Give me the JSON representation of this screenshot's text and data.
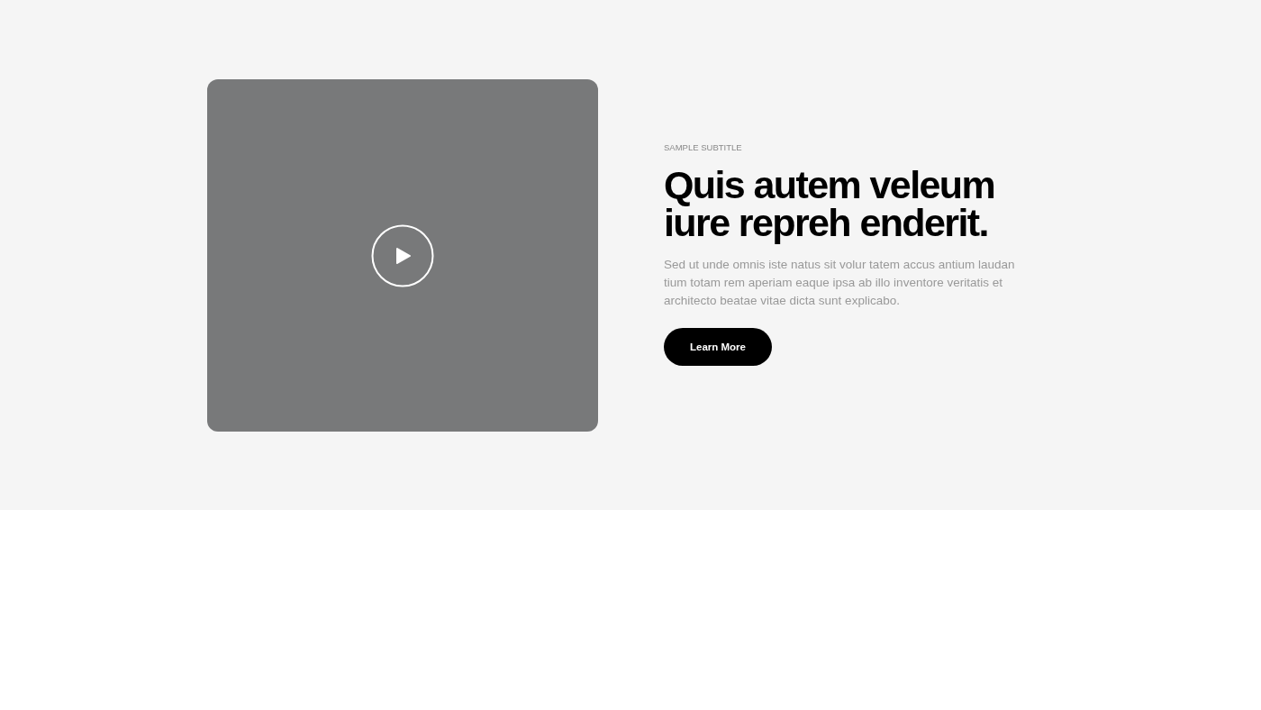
{
  "hero": {
    "subtitle": "SAMPLE SUBTITLE",
    "title": "Quis autem veleum iure repreh enderit.",
    "body": "Sed ut unde omnis iste natus sit volur tatem accus antium laudan tium totam rem aperiam eaque ipsa ab illo inventore veritatis et architecto beatae vitae dicta sunt explicabo.",
    "button": "Learn More"
  }
}
